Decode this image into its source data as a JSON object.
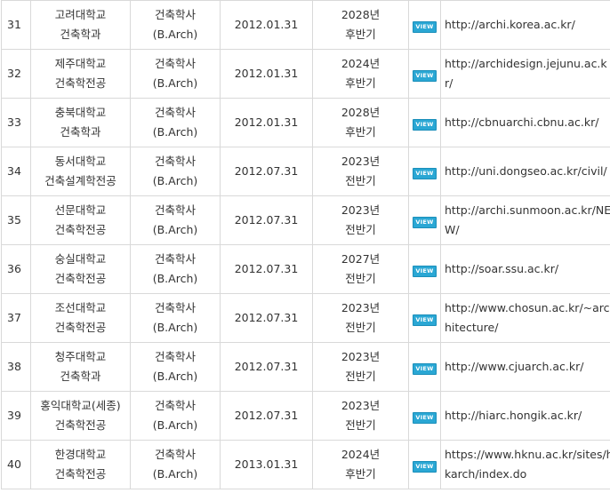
{
  "view_label": "VIEW",
  "rows": [
    {
      "no": "31",
      "univ": "고려대학교",
      "dept": "건축학과",
      "degree": "건축학사",
      "degree_en": "(B.Arch)",
      "date": "2012.01.31",
      "valid_year": "2028년",
      "valid_half": "후반기",
      "url": "http://archi.korea.ac.kr/"
    },
    {
      "no": "32",
      "univ": "제주대학교",
      "dept": "건축학전공",
      "degree": "건축학사",
      "degree_en": "(B.Arch)",
      "date": "2012.01.31",
      "valid_year": "2024년",
      "valid_half": "후반기",
      "url": "http://archidesign.jejunu.ac.kr/"
    },
    {
      "no": "33",
      "univ": "충북대학교",
      "dept": "건축학과",
      "degree": "건축학사",
      "degree_en": "(B.Arch)",
      "date": "2012.01.31",
      "valid_year": "2028년",
      "valid_half": "후반기",
      "url": "http://cbnuarchi.cbnu.ac.kr/"
    },
    {
      "no": "34",
      "univ": "동서대학교",
      "dept": "건축설계학전공",
      "degree": "건축학사",
      "degree_en": "(B.Arch)",
      "date": "2012.07.31",
      "valid_year": "2023년",
      "valid_half": "전반기",
      "url": "http://uni.dongseo.ac.kr/civil/"
    },
    {
      "no": "35",
      "univ": "선문대학교",
      "dept": "건축학전공",
      "degree": "건축학사",
      "degree_en": "(B.Arch)",
      "date": "2012.07.31",
      "valid_year": "2023년",
      "valid_half": "전반기",
      "url": "http://archi.sunmoon.ac.kr/NEW/"
    },
    {
      "no": "36",
      "univ": "숭실대학교",
      "dept": "건축학전공",
      "degree": "건축학사",
      "degree_en": "(B.Arch)",
      "date": "2012.07.31",
      "valid_year": "2027년",
      "valid_half": "전반기",
      "url": "http://soar.ssu.ac.kr/"
    },
    {
      "no": "37",
      "univ": "조선대학교",
      "dept": "건축학전공",
      "degree": "건축학사",
      "degree_en": "(B.Arch)",
      "date": "2012.07.31",
      "valid_year": "2023년",
      "valid_half": "전반기",
      "url": "http://www.chosun.ac.kr/~architecture/"
    },
    {
      "no": "38",
      "univ": "청주대학교",
      "dept": "건축학과",
      "degree": "건축학사",
      "degree_en": "(B.Arch)",
      "date": "2012.07.31",
      "valid_year": "2023년",
      "valid_half": "전반기",
      "url": "http://www.cjuarch.ac.kr/"
    },
    {
      "no": "39",
      "univ": "홍익대학교(세종)",
      "dept": "건축학전공",
      "degree": "건축학사",
      "degree_en": "(B.Arch)",
      "date": "2012.07.31",
      "valid_year": "2023년",
      "valid_half": "전반기",
      "url": "http://hiarc.hongik.ac.kr/"
    },
    {
      "no": "40",
      "univ": "한경대학교",
      "dept": "건축학전공",
      "degree": "건축학사",
      "degree_en": "(B.Arch)",
      "date": "2013.01.31",
      "valid_year": "2024년",
      "valid_half": "후반기",
      "url": "https://www.hknu.ac.kr/sites/hkarch/index.do"
    }
  ]
}
